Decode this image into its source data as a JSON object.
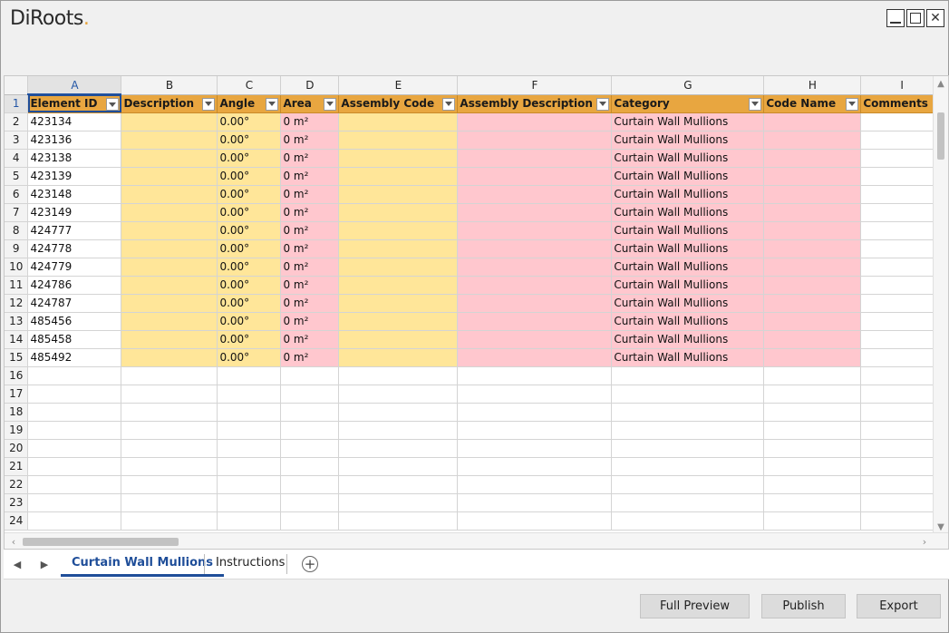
{
  "app": {
    "logo_text": "DiRoots"
  },
  "window_controls": {
    "minimize": "",
    "maximize": "",
    "close": "✕"
  },
  "columns": [
    "A",
    "B",
    "C",
    "D",
    "E",
    "F",
    "G",
    "H",
    "I"
  ],
  "header_row": {
    "row_number": "1",
    "fields": [
      "Element ID",
      "Description",
      "Angle",
      "Area",
      "Assembly Code",
      "Assembly Description",
      "Category",
      "Code Name",
      "Comments"
    ]
  },
  "rows": [
    {
      "n": "2",
      "id": "423134",
      "angle": "0.00°",
      "area": "0 m²",
      "category": "Curtain Wall Mullions"
    },
    {
      "n": "3",
      "id": "423136",
      "angle": "0.00°",
      "area": "0 m²",
      "category": "Curtain Wall Mullions"
    },
    {
      "n": "4",
      "id": "423138",
      "angle": "0.00°",
      "area": "0 m²",
      "category": "Curtain Wall Mullions"
    },
    {
      "n": "5",
      "id": "423139",
      "angle": "0.00°",
      "area": "0 m²",
      "category": "Curtain Wall Mullions"
    },
    {
      "n": "6",
      "id": "423148",
      "angle": "0.00°",
      "area": "0 m²",
      "category": "Curtain Wall Mullions"
    },
    {
      "n": "7",
      "id": "423149",
      "angle": "0.00°",
      "area": "0 m²",
      "category": "Curtain Wall Mullions"
    },
    {
      "n": "8",
      "id": "424777",
      "angle": "0.00°",
      "area": "0 m²",
      "category": "Curtain Wall Mullions"
    },
    {
      "n": "9",
      "id": "424778",
      "angle": "0.00°",
      "area": "0 m²",
      "category": "Curtain Wall Mullions"
    },
    {
      "n": "10",
      "id": "424779",
      "angle": "0.00°",
      "area": "0 m²",
      "category": "Curtain Wall Mullions"
    },
    {
      "n": "11",
      "id": "424786",
      "angle": "0.00°",
      "area": "0 m²",
      "category": "Curtain Wall Mullions"
    },
    {
      "n": "12",
      "id": "424787",
      "angle": "0.00°",
      "area": "0 m²",
      "category": "Curtain Wall Mullions"
    },
    {
      "n": "13",
      "id": "485456",
      "angle": "0.00°",
      "area": "0 m²",
      "category": "Curtain Wall Mullions"
    },
    {
      "n": "14",
      "id": "485458",
      "angle": "0.00°",
      "area": "0 m²",
      "category": "Curtain Wall Mullions"
    },
    {
      "n": "15",
      "id": "485492",
      "angle": "0.00°",
      "area": "0 m²",
      "category": "Curtain Wall Mullions"
    }
  ],
  "empty_rows": [
    "16",
    "17",
    "18",
    "19",
    "20",
    "21",
    "22",
    "23",
    "24"
  ],
  "tabs": [
    {
      "label": "Curtain Wall Mullions",
      "active": true
    },
    {
      "label": "Instructions",
      "active": false
    }
  ],
  "buttons": {
    "full_preview": "Full Preview",
    "publish": "Publish",
    "export": "Export"
  },
  "colors": {
    "header_fill": "#e8a640",
    "editable_fill": "#ffe699",
    "readonly_fill": "#ffc7ce",
    "accent": "#1f4e99"
  }
}
